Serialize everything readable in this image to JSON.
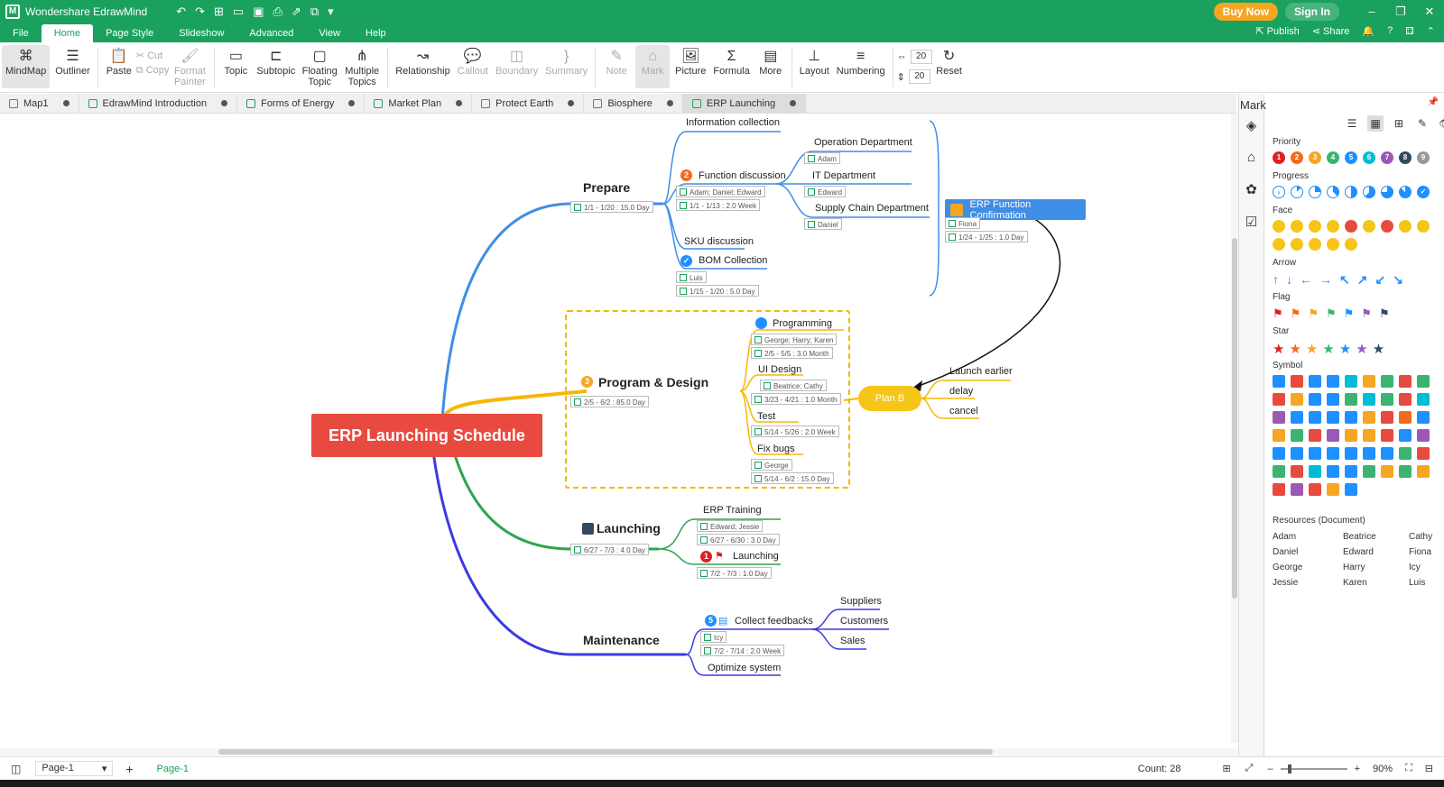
{
  "app": {
    "title": "Wondershare EdrawMind",
    "buy_now": "Buy Now",
    "sign_in": "Sign In"
  },
  "menu": {
    "items": [
      "File",
      "Home",
      "Page Style",
      "Slideshow",
      "Advanced",
      "View",
      "Help"
    ],
    "publish": "Publish",
    "share": "Share"
  },
  "ribbon": {
    "mindmap": "MindMap",
    "outliner": "Outliner",
    "paste": "Paste",
    "cut": "Cut",
    "copy": "Copy",
    "format_painter": "Format Painter",
    "topic": "Topic",
    "subtopic": "Subtopic",
    "floating_topic": "Floating Topic",
    "multiple_topics": "Multiple Topics",
    "relationship": "Relationship",
    "callout": "Callout",
    "boundary": "Boundary",
    "summary": "Summary",
    "note": "Note",
    "mark": "Mark",
    "picture": "Picture",
    "formula": "Formula",
    "more": "More",
    "layout": "Layout",
    "numbering": "Numbering",
    "spacing_h": "20",
    "spacing_v": "20",
    "reset": "Reset"
  },
  "tabs": [
    "Map1",
    "EdrawMind Introduction",
    "Forms of Energy",
    "Market Plan",
    "Protect Earth",
    "Biosphere",
    "ERP Launching"
  ],
  "map": {
    "root": "ERP Launching Schedule",
    "prepare": {
      "label": "Prepare",
      "info": "1/1 - 1/20 : 15.0 Day"
    },
    "info_collection": "Information collection",
    "function_discussion": {
      "label": "Function discussion",
      "res": "Adam; Daniel; Edward",
      "info": "1/1 - 1/13 : 2.0 Week"
    },
    "operation_dept": {
      "label": "Operation Department",
      "res": "Adam"
    },
    "it_dept": {
      "label": "IT Department",
      "res": "Edward"
    },
    "supply_chain": {
      "label": "Supply Chain  Department",
      "res": "Daniel"
    },
    "sku": "SKU discussion",
    "bom": {
      "label": "BOM Collection",
      "res": "Luis",
      "info": "1/15 - 1/20 : 5.0 Day"
    },
    "erp_conf": {
      "label": "ERP Function Confirmation",
      "res": "Fiona",
      "info": "1/24 - 1/25 : 1.0 Day"
    },
    "program_design": {
      "label": "Program & Design",
      "info": "2/5 - 6/2 : 85.0 Day"
    },
    "programming": {
      "label": "Programming",
      "res": "George; Harry; Karen",
      "info": "2/5 - 5/5 : 3.0 Month"
    },
    "ui_design": {
      "label": "UI Design",
      "res": "Beatrice; Cathy",
      "info": "3/23 - 4/21 : 1.0 Month"
    },
    "test": {
      "label": "Test",
      "info": "5/14 - 5/26 : 2.0 Week"
    },
    "fix_bugs": {
      "label": "Fix bugs",
      "res": "George",
      "info": "5/14 - 6/2 : 15.0 Day"
    },
    "plan_b": "Plan B",
    "launch_earlier": "Launch earlier",
    "delay": "delay",
    "cancel": "cancel",
    "launching": {
      "label": "Launching",
      "info": "6/27 - 7/3 : 4.0 Day"
    },
    "erp_training": {
      "label": "ERP Training",
      "res": "Edward; Jessie",
      "info": "6/27 - 6/30 : 3.0 Day"
    },
    "launching_sub": {
      "label": "Launching",
      "info": "7/2 - 7/3 : 1.0 Day"
    },
    "maintenance": "Maintenance",
    "collect_feedbacks": {
      "label": "Collect feedbacks",
      "res": "Icy",
      "info": "7/2 - 7/14 : 2.0 Week"
    },
    "suppliers": "Suppliers",
    "customers": "Customers",
    "sales": "Sales",
    "optimize": "Optimize system"
  },
  "panel": {
    "title": "Mark",
    "priority": "Priority",
    "progress": "Progress",
    "face": "Face",
    "arrow": "Arrow",
    "flag": "Flag",
    "star": "Star",
    "symbol": "Symbol",
    "priority_nums": [
      "1",
      "2",
      "3",
      "4",
      "5",
      "6",
      "7",
      "8",
      "9"
    ],
    "priority_colors": [
      "#e02020",
      "#f26b1d",
      "#f5a623",
      "#3cb371",
      "#1e90ff",
      "#00bcd4",
      "#9b59b6",
      "#34495e",
      "#999999"
    ],
    "arrows": [
      "↑",
      "↓",
      "←",
      "→",
      "↖",
      "↗",
      "↙",
      "↘"
    ],
    "flag_colors": [
      "#e02020",
      "#f26b1d",
      "#f5a623",
      "#3cb371",
      "#1e90ff",
      "#9b59b6",
      "#34495e"
    ],
    "star_colors": [
      "#e02020",
      "#f26b1d",
      "#f5a623",
      "#3cb371",
      "#1e90ff",
      "#9b59b6",
      "#34495e"
    ],
    "resources_title": "Resources (Document)",
    "resources": [
      "Adam",
      "Beatrice",
      "Cathy",
      "Daniel",
      "Edward",
      "Fiona",
      "George",
      "Harry",
      "Icy",
      "Jessie",
      "Karen",
      "Luis"
    ]
  },
  "status": {
    "page_select": "Page-1",
    "page_tab": "Page-1",
    "count": "Count: 28",
    "zoom": "90%"
  }
}
